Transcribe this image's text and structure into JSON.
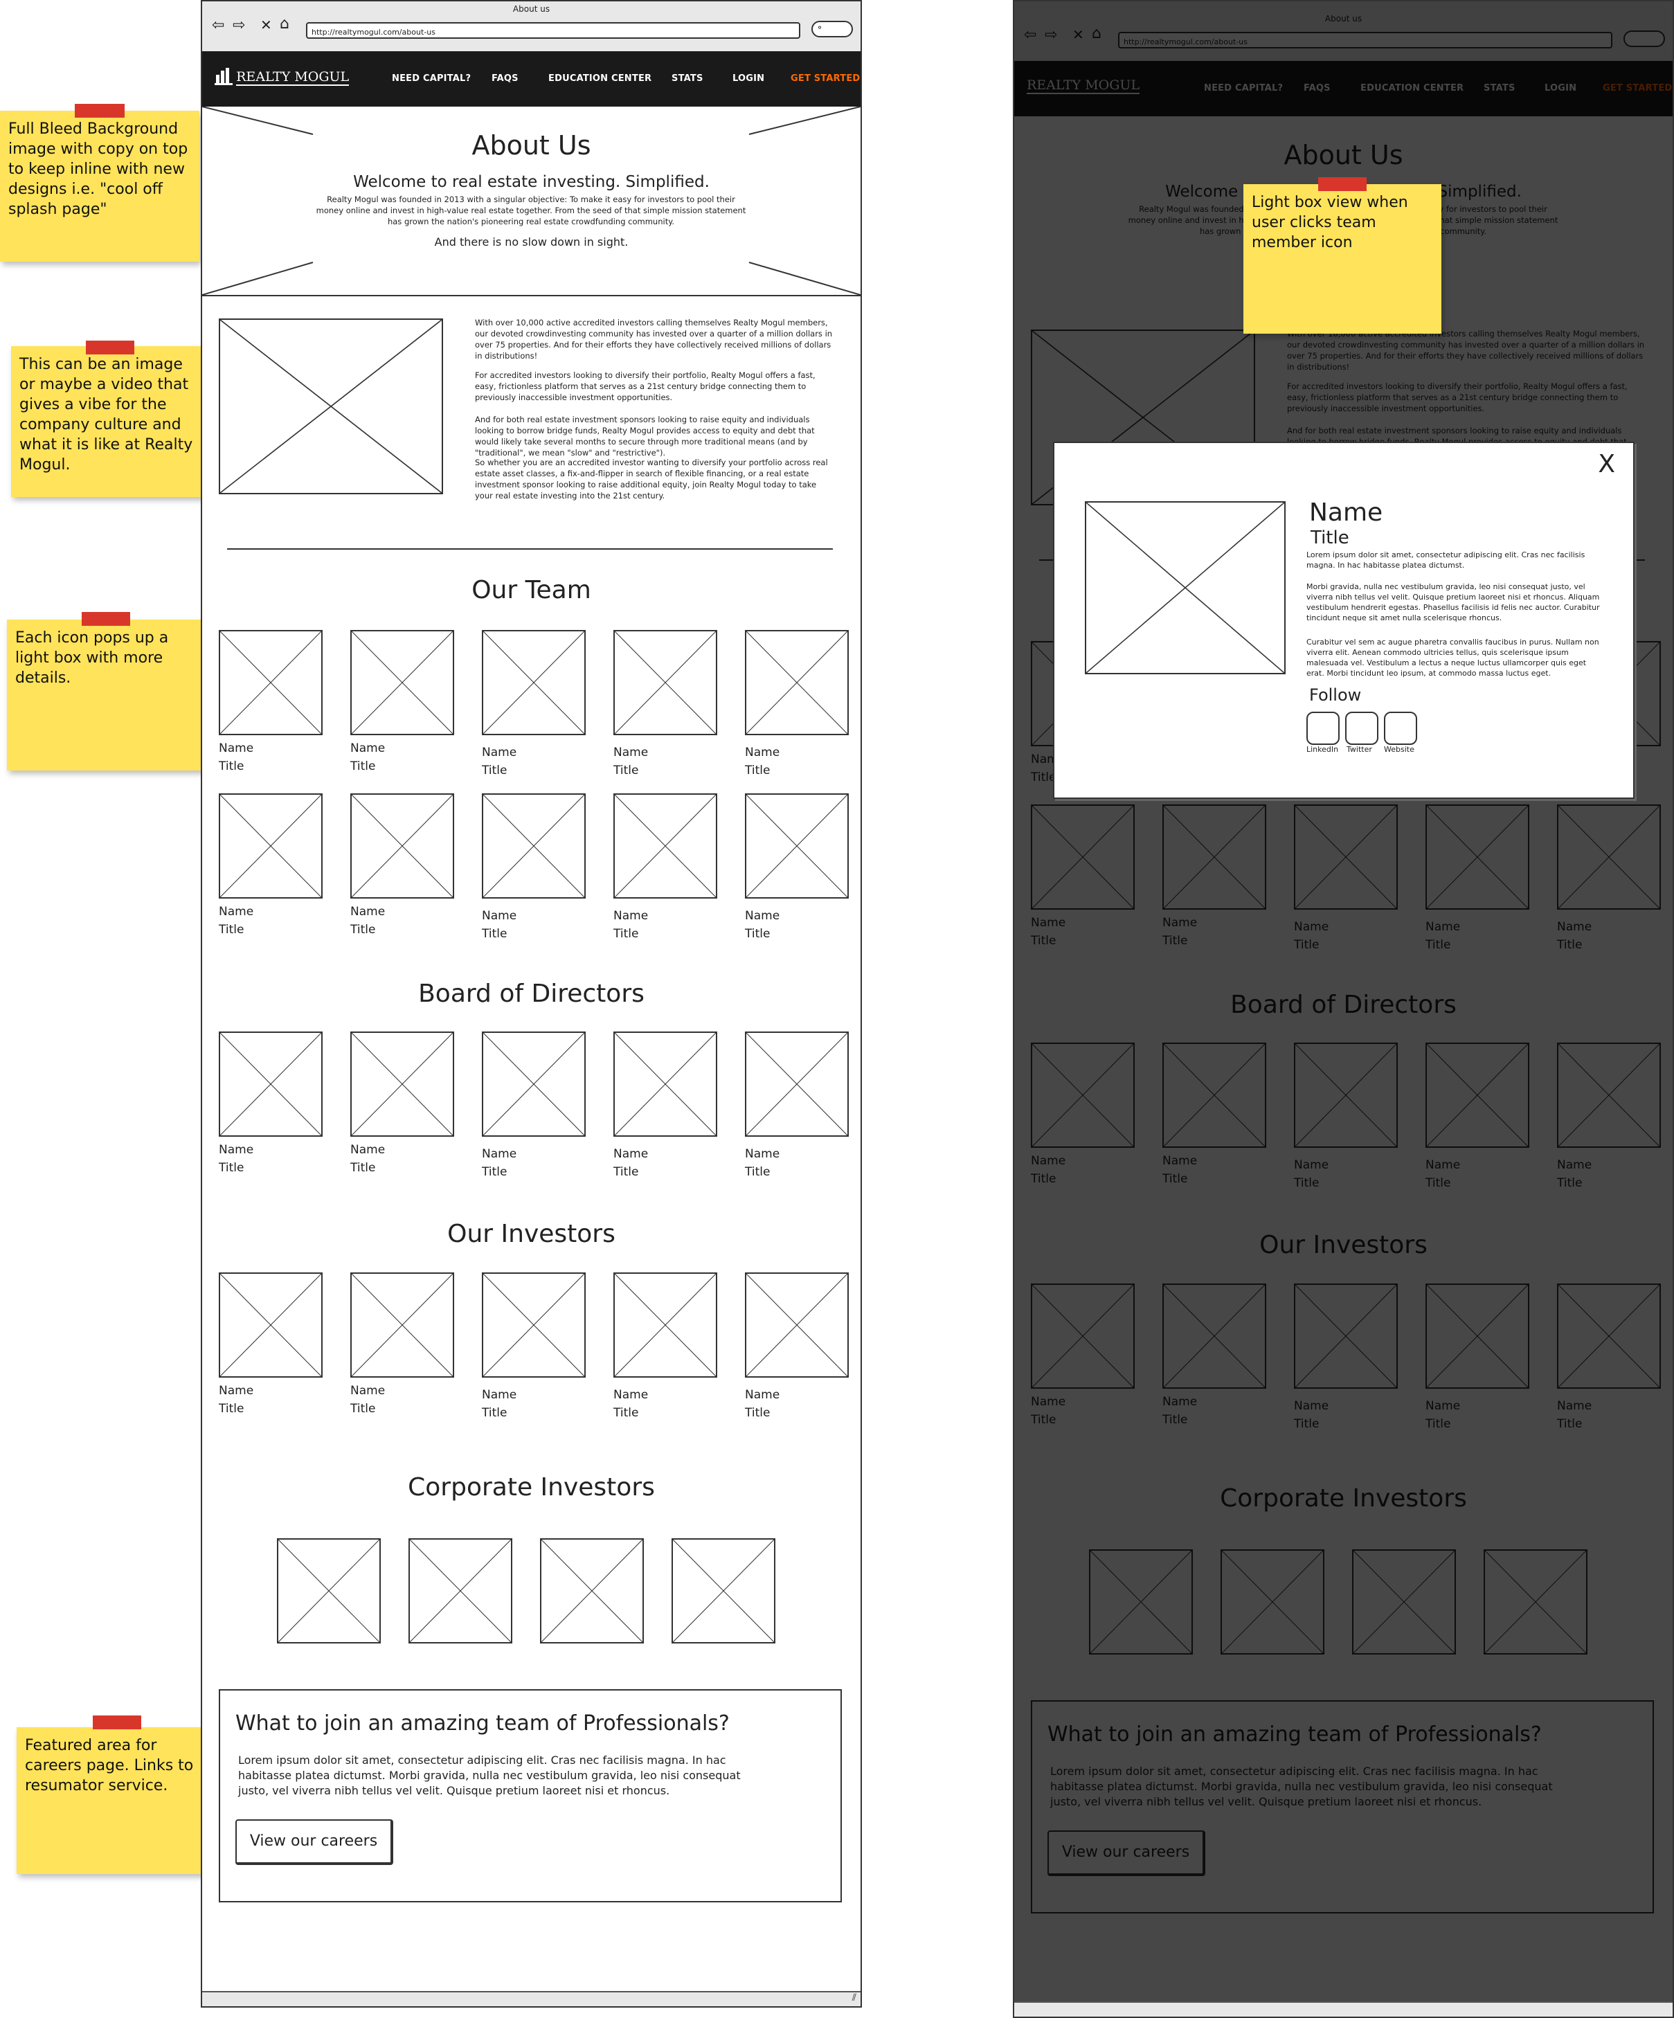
{
  "browser": {
    "window_title": "About us",
    "url": "http://realtymogul.com/about-us"
  },
  "nav": {
    "logo": "REALTY MOGUL",
    "links": [
      "NEED CAPITAL?",
      "FAQS",
      "EDUCATION CENTER",
      "STATS",
      "LOGIN"
    ],
    "cta": "GET STARTED",
    "cta_color": "#ff6a00"
  },
  "hero": {
    "title": "About Us",
    "subtitle": "Welcome to real estate investing. Simplified.",
    "body": "Realty Mogul was founded in 2013 with a singular objective: To make it easy for investors to pool their money online and invest in high-value real estate together. From the seed of that simple mission statement has grown the nation's pioneering real estate crowdfunding community.",
    "tagline": "And there is no slow down in sight."
  },
  "intro": {
    "paragraphs": [
      "With over 10,000 active accredited investors calling themselves Realty Mogul members, our devoted crowdinvesting community has invested over a quarter of a million dollars in over 75 properties. And for their efforts they have collectively received millions of dollars in distributions!",
      "For accredited investors looking to diversify their portfolio, Realty Mogul offers a fast, easy, frictionless platform that serves as a 21st century bridge connecting them to previously inaccessible investment opportunities.",
      "And for both real estate investment sponsors looking to raise equity and individuals looking to borrow bridge funds, Realty Mogul provides access to equity and debt that would likely take several months to secure through more traditional means (and by \"traditional\", we mean \"slow\" and \"restrictive\").",
      "So whether you are an accredited investor wanting to diversify your portfolio across real estate asset classes, a fix-and-flipper in search of flexible financing, or a real estate investment sponsor looking to raise additional equity, join Realty Mogul today to take your real estate investing into the 21st century."
    ]
  },
  "sections": {
    "team": "Our Team",
    "board": "Board of Directors",
    "investors": "Our Investors",
    "corporate": "Corporate Investors"
  },
  "member": {
    "name": "Name",
    "title": "Title"
  },
  "careers": {
    "heading": "What to join an amazing team of Professionals?",
    "body": "Lorem ipsum dolor sit amet, consectetur adipiscing elit. Cras nec facilisis magna. In hac habitasse platea dictumst. Morbi gravida, nulla nec vestibulum gravida, leo nisi consequat justo, vel viverra nibh tellus vel velit. Quisque pretium laoreet nisi et rhoncus.",
    "button": "View our careers"
  },
  "notes": {
    "hero_bg": "Full Bleed Background image with copy on top to keep inline with new designs i.e. \"cool off splash page\"",
    "intro_media": "This can be an image or maybe a video that gives a vibe for the company culture and what it is like at Realty Mogul.",
    "team_icons": "Each icon pops up a light box with more details.",
    "careers": "Featured area for careers page. Links to resumator service.",
    "lightbox": "Light box view when user clicks team member icon"
  },
  "lightbox": {
    "close": "X",
    "name": "Name",
    "title": "Title",
    "paragraphs": [
      "Lorem ipsum dolor sit amet, consectetur adipiscing elit. Cras nec facilisis magna. In hac habitasse platea dictumst.",
      "Morbi gravida, nulla nec vestibulum gravida, leo nisi consequat justo, vel viverra nibh tellus vel velit. Quisque pretium laoreet nisi et rhoncus. Aliquam vestibulum hendrerit egestas. Phasellus facilisis id felis nec auctor. Curabitur tincidunt neque sit amet nulla scelerisque rhoncus.",
      "Curabitur vel sem ac augue pharetra convallis faucibus in purus. Nullam non viverra elit. Aenean commodo ultricies tellus, quis scelerisque ipsum malesuada vel. Vestibulum a lectus a neque luctus ullamcorper quis eget erat. Morbi tincidunt leo ipsum, at commodo massa luctus eget."
    ],
    "follow": "Follow",
    "social": [
      "LinkedIn",
      "Twitter",
      "Website"
    ]
  },
  "colors": {
    "sticky": "#ffe35a",
    "tape": "#d9362b",
    "nav_bg": "#1a1a1a",
    "overlay": "#000000"
  }
}
